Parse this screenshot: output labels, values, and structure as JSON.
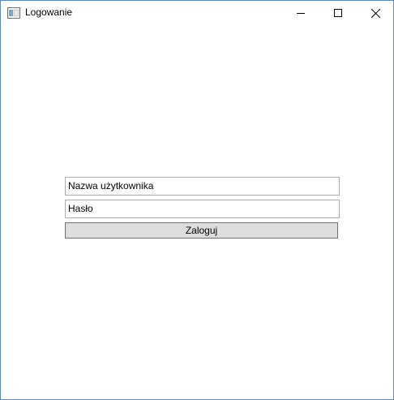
{
  "window": {
    "title": "Logowanie",
    "icon": "window-app-icon",
    "controls": {
      "minimize": "minimize-icon",
      "maximize": "maximize-icon",
      "close": "close-icon"
    }
  },
  "form": {
    "username_value": "Nazwa użytkownika",
    "password_value": "Hasło",
    "login_label": "Zaloguj"
  },
  "colors": {
    "window_border": "#5a8bbf",
    "button_bg": "#dddddd",
    "field_border": "#abadb3"
  }
}
